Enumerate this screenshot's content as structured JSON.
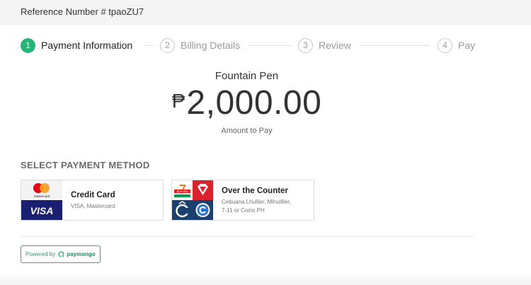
{
  "header": {
    "reference": "Reference Number # tpaoZU7"
  },
  "steps": [
    {
      "number": "1",
      "label": "Payment Information",
      "active": true
    },
    {
      "number": "2",
      "label": "Billing Details",
      "active": false
    },
    {
      "number": "3",
      "label": "Review",
      "active": false
    },
    {
      "number": "4",
      "label": "Pay",
      "active": false
    }
  ],
  "summary": {
    "product": "Fountain Pen",
    "currency_symbol": "₱",
    "amount": "2,000.00",
    "amount_caption": "Amount to Pay"
  },
  "payment_methods": {
    "title": "SELECT PAYMENT METHOD",
    "credit_card": {
      "title": "Credit Card",
      "subtitle": "VISA, Mastercard",
      "logo_text_mastercard": "mastercard",
      "logo_text_visa": "VISA"
    },
    "otc": {
      "title": "Over the Counter",
      "subtitle_line1": "Cebuana Lhullier, Mlhuillier,",
      "subtitle_line2": "7-11 or Coins PH",
      "logo_text_711": "ELEVEN"
    }
  },
  "footer": {
    "powered_by": "Powered by",
    "brand": "paymongo"
  },
  "colors": {
    "accent": "#27b477",
    "visa_blue": "#1a1f71",
    "mc_red": "#eb001b",
    "mc_orange": "#f79e1b"
  },
  "icons": [
    "mastercard-logo",
    "visa-logo",
    "seven-eleven-logo",
    "mlhuillier-logo",
    "cebuana-logo",
    "coins-ph-logo",
    "paymongo-logo-icon"
  ]
}
